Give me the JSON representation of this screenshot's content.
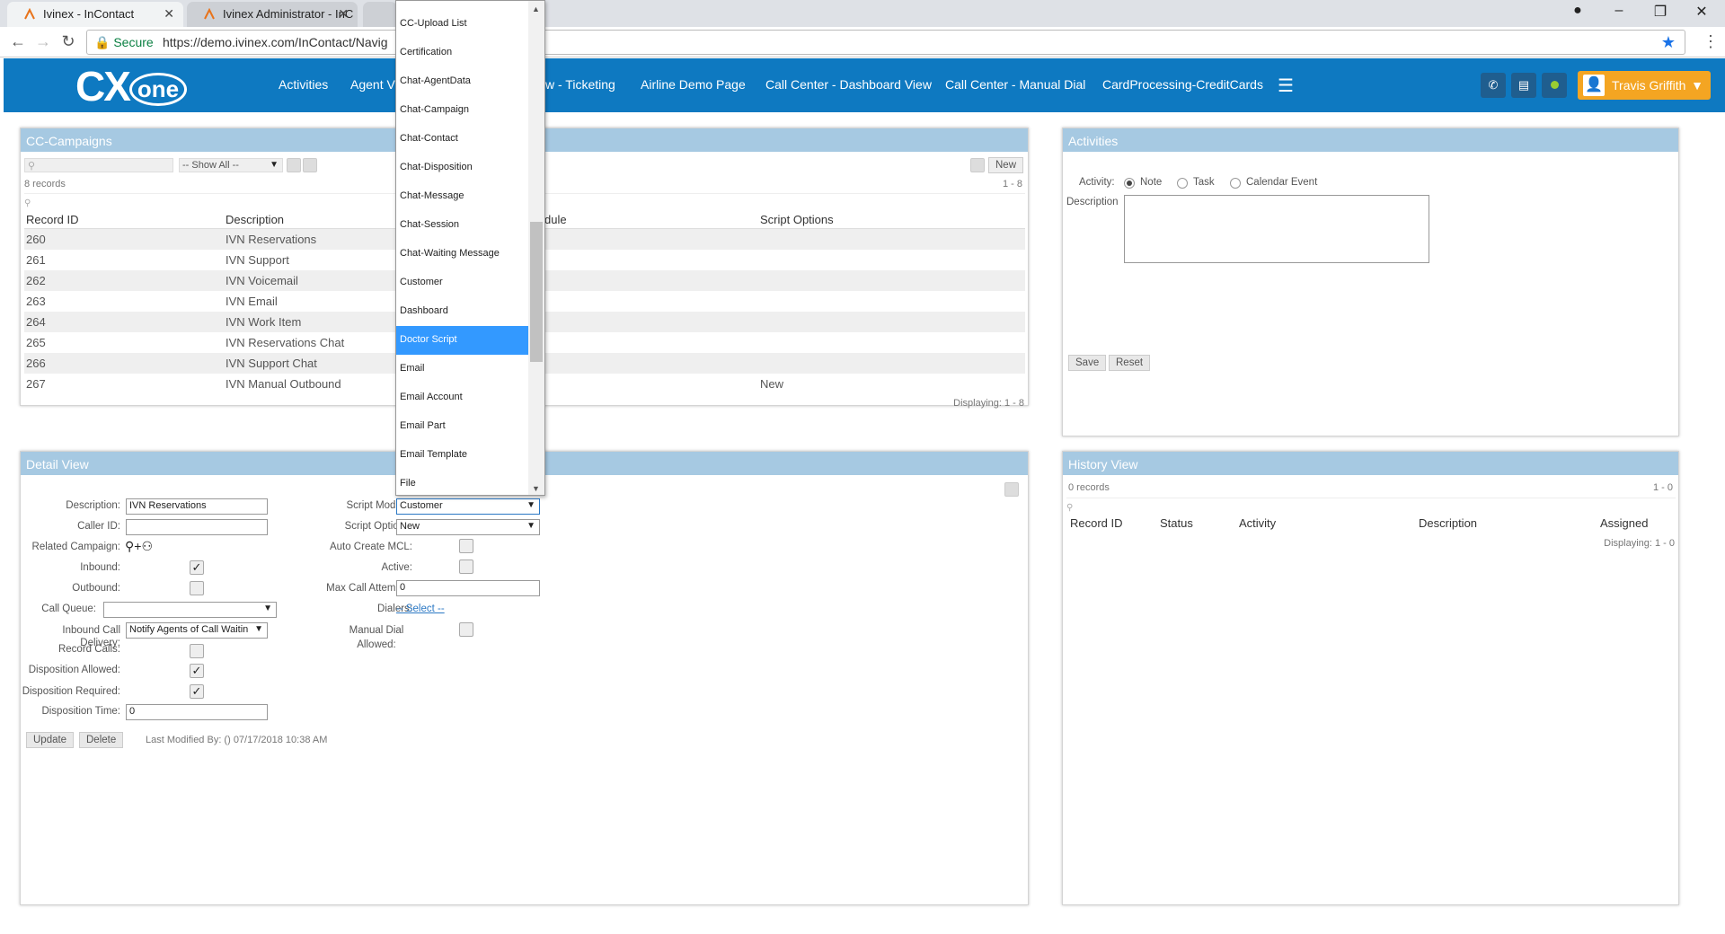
{
  "browser": {
    "tabs": [
      {
        "title": "Ivinex - InContact"
      },
      {
        "title": "Ivinex Administrator - InC"
      }
    ],
    "secure_label": "Secure",
    "url": "https://demo.ivinex.com/InContact/Navig"
  },
  "header": {
    "logo_text": "CX",
    "logo_sub": "one",
    "nav": [
      {
        "label": "Activities"
      },
      {
        "label": "Agent V"
      },
      {
        "label": "w - Ticketing"
      },
      {
        "label": "Airline Demo Page"
      },
      {
        "label": "Call Center - Dashboard View"
      },
      {
        "label": "Call Center - Manual Dial"
      },
      {
        "label": "CardProcessing-CreditCards"
      }
    ],
    "user_name": "Travis Griffith"
  },
  "campaigns": {
    "title": "CC-Campaigns",
    "filter_value": "-- Show All --",
    "record_count": "8 records",
    "new_label": "New",
    "range": "1 - 8",
    "columns": [
      "Record ID",
      "Description",
      "dule",
      "Script Options"
    ],
    "rows": [
      {
        "id": "260",
        "desc": "IVN Reservations",
        "opt": ""
      },
      {
        "id": "261",
        "desc": "IVN Support",
        "opt": ""
      },
      {
        "id": "262",
        "desc": "IVN Voicemail",
        "opt": ""
      },
      {
        "id": "263",
        "desc": "IVN Email",
        "opt": ""
      },
      {
        "id": "264",
        "desc": "IVN Work Item",
        "opt": ""
      },
      {
        "id": "265",
        "desc": "IVN Reservations Chat",
        "opt": ""
      },
      {
        "id": "266",
        "desc": "IVN Support Chat",
        "opt": ""
      },
      {
        "id": "267",
        "desc": "IVN Manual Outbound",
        "opt": "New"
      }
    ],
    "displaying": "Displaying: 1 - 8"
  },
  "dropdown": {
    "items": [
      {
        "label": "CC-Upload List"
      },
      {
        "label": "Certification"
      },
      {
        "label": "Chat-AgentData"
      },
      {
        "label": "Chat-Campaign"
      },
      {
        "label": "Chat-Contact"
      },
      {
        "label": "Chat-Disposition"
      },
      {
        "label": "Chat-Message"
      },
      {
        "label": "Chat-Session"
      },
      {
        "label": "Chat-Waiting Message"
      },
      {
        "label": "Customer"
      },
      {
        "label": "Dashboard"
      },
      {
        "label": "Doctor Script"
      },
      {
        "label": "Email"
      },
      {
        "label": "Email Account"
      },
      {
        "label": "Email Part"
      },
      {
        "label": "Email Template"
      },
      {
        "label": "File"
      }
    ]
  },
  "activities": {
    "title": "Activities",
    "activity_label": "Activity:",
    "options": [
      "Note",
      "Task",
      "Calendar Event"
    ],
    "description_label": "Description",
    "save_label": "Save",
    "reset_label": "Reset"
  },
  "detail": {
    "title": "Detail View",
    "description_label": "Description:",
    "description_value": "IVN Reservations",
    "caller_id_label": "Caller ID:",
    "related_campaign_label": "Related Campaign:",
    "inbound_label": "Inbound:",
    "outbound_label": "Outbound:",
    "call_queue_label": "Call Queue:",
    "inbound_call_delivery_label": "Inbound Call Delivery:",
    "inbound_call_delivery_value": "Notify Agents of Call Waitin",
    "record_calls_label": "Record Calls:",
    "disposition_allowed_label": "Disposition Allowed:",
    "disposition_required_label": "Disposition Required:",
    "disposition_time_label": "Disposition Time:",
    "disposition_time_value": "0",
    "script_module_label": "Script Module:",
    "script_module_value": "Customer",
    "script_options_label": "Script Options:",
    "script_options_value": "New",
    "auto_create_label": "Auto Create MCL:",
    "active_label": "Active:",
    "max_attempts_label": "Max Call Attempts:",
    "max_attempts_value": "0",
    "dialers_label": "Dialers:",
    "dialers_value": "-- Select --",
    "manual_dial_label": "Manual Dial Allowed:",
    "update_label": "Update",
    "delete_label": "Delete",
    "last_modified": "Last Modified By: () 07/17/2018 10:38 AM"
  },
  "history": {
    "title": "History View",
    "record_count": "0 records",
    "range": "1 - 0",
    "columns": [
      "Record ID",
      "Status",
      "Activity",
      "Description",
      "Assigned"
    ],
    "displaying": "Displaying: 1 - 0"
  }
}
